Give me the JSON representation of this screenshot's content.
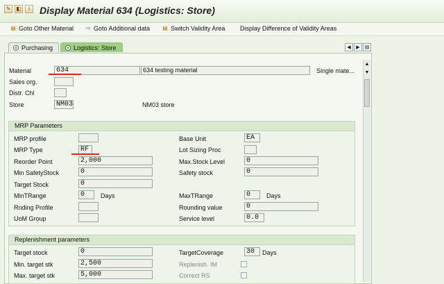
{
  "window": {
    "title": "Display Material 634 (Logistics: Store)"
  },
  "toolbar": {
    "goto_other_material": "Goto Other Material",
    "goto_additional_data": "Goto Additional data",
    "switch_validity_area": "Switch Validity Area",
    "display_difference": "Display Difference of Validity Areas"
  },
  "tabs": [
    {
      "label": "Purchasing",
      "active": false
    },
    {
      "label": "Logistics: Store",
      "active": true
    }
  ],
  "header": {
    "material_label": "Material",
    "material_value": "634",
    "material_desc": "634 testing material",
    "material_type": "Single mate...",
    "sales_org_label": "Sales org.",
    "sales_org_value": "",
    "distr_chl_label": "Distr. Chl",
    "distr_chl_value": "",
    "store_label": "Store",
    "store_value": "NM03",
    "store_desc": "NM03 store"
  },
  "mrp": {
    "title": "MRP Parameters",
    "mrp_profile_label": "MRP profile",
    "mrp_profile_value": "",
    "mrp_type_label": "MRP Type",
    "mrp_type_value": "RF",
    "reorder_point_label": "Reorder Point",
    "reorder_point_value": "2,000",
    "min_safety_stock_label": "Min SafetyStock",
    "min_safety_stock_value": "0",
    "target_stock_label": "Target Stock",
    "target_stock_value": "0",
    "min_trange_label": "MinTRange",
    "min_trange_value": "0",
    "min_trange_unit": "Days",
    "rnding_profile_label": "Rnding Profile",
    "rnding_profile_value": "",
    "uom_group_label": "UoM Group",
    "uom_group_value": "",
    "base_unit_label": "Base Unit",
    "base_unit_value": "EA",
    "lot_sizing_label": "Lot Sizing Proc",
    "lot_sizing_value": "",
    "max_stock_label": "Max.Stock Level",
    "max_stock_value": "0",
    "safety_stock_label": "Safety stock",
    "safety_stock_value": "0",
    "max_trange_label": "MaxTRange",
    "max_trange_value": "0",
    "max_trange_unit": "Days",
    "rounding_value_label": "Rounding value",
    "rounding_value_value": "0",
    "service_level_label": "Service level",
    "service_level_value": "0.0"
  },
  "replenishment": {
    "title": "Replenishment parameters",
    "target_stock_label": "Target stock",
    "target_stock_value": "0",
    "min_target_stk_label": "Min. target stk",
    "min_target_stk_value": "2,500",
    "max_target_stk_label": "Max. target stk",
    "max_target_stk_value": "5,000",
    "target_coverage_label": "TargetCoverage",
    "target_coverage_value": "30",
    "target_coverage_unit": "Days",
    "replenish_im_label": "Replenish. IM",
    "correct_rs_label": "Correct RS"
  },
  "colors": {
    "active_tab": "#9fd07f",
    "annotation": "#e0221c"
  },
  "icons": [
    "display-change-icon",
    "goto-other-material-icon",
    "goto-additional-data-icon",
    "switch-validity-area-icon",
    "tab-scroll-left-icon",
    "tab-scroll-right-icon",
    "tab-list-icon",
    "scroll-up-icon",
    "scroll-down-icon"
  ]
}
